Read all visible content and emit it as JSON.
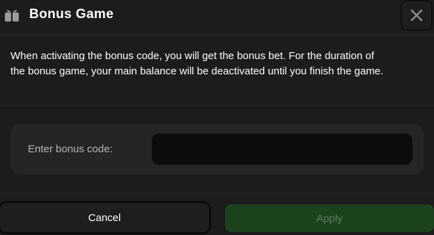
{
  "dialog": {
    "title": "Bonus Game",
    "message": "When activating the bonus code, you will get the bonus bet. For the duration of the bonus game, your main balance will be deactivated until you finish the game.",
    "code_label": "Enter bonus code:",
    "code_value": "",
    "cancel_label": "Cancel",
    "apply_label": "Apply",
    "icons": {
      "header": "gift-icon",
      "close": "close-icon"
    },
    "colors": {
      "background": "#1c1c1c",
      "apply": "#1b421d",
      "apply_text": "#5f7f60",
      "input": "#0c0c0c"
    }
  }
}
